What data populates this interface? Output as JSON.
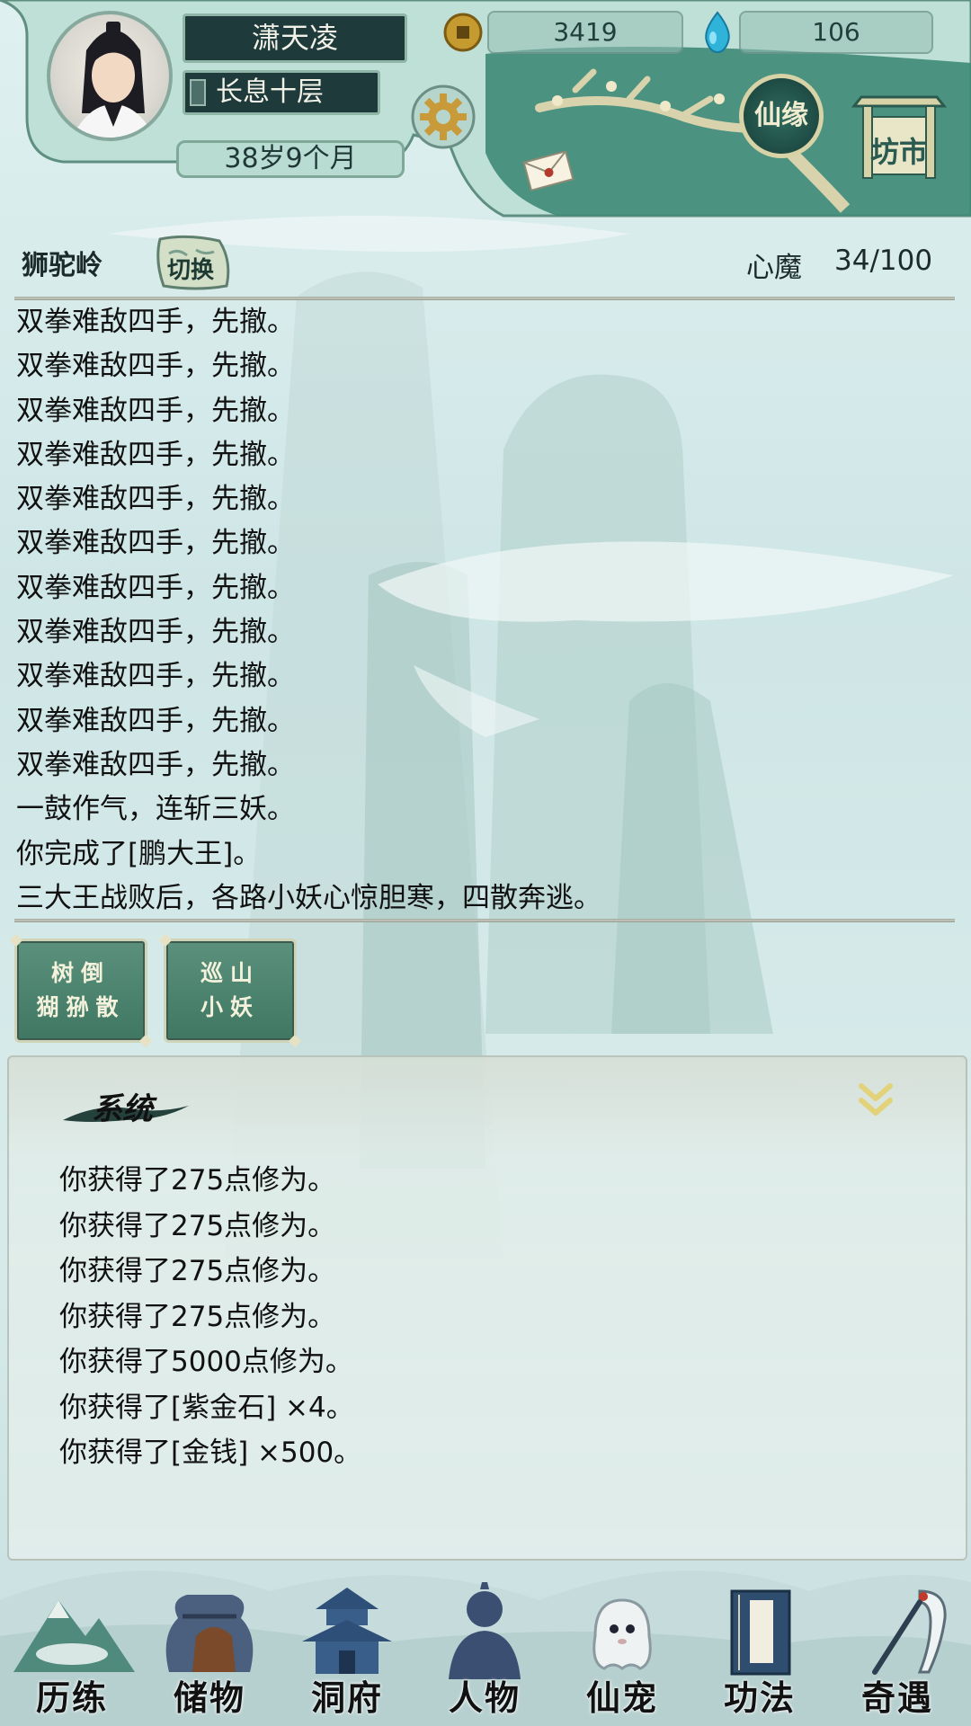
{
  "player": {
    "name": "潇天凌",
    "realm": "长息十层",
    "age": "38岁9个月"
  },
  "resources": {
    "coins": "3419",
    "gems": "106"
  },
  "header_buttons": {
    "xianyuan": "仙缘",
    "fangshi": "坊市"
  },
  "location": {
    "name": "狮驼岭",
    "switch_label": "切换"
  },
  "xinmo": {
    "label": "心魔",
    "value": "34/100"
  },
  "story_log": [
    "双拳难敌四手，先撤。",
    "双拳难敌四手，先撤。",
    "双拳难敌四手，先撤。",
    "双拳难敌四手，先撤。",
    "双拳难敌四手，先撤。",
    "双拳难敌四手，先撤。",
    "双拳难敌四手，先撤。",
    "双拳难敌四手，先撤。",
    "双拳难敌四手，先撤。",
    "双拳难敌四手，先撤。",
    "双拳难敌四手，先撤。",
    "一鼓作气，连斩三妖。",
    "你完成了[鹏大王]。",
    "三大王战败后，各路小妖心惊胆寒，四散奔逃。"
  ],
  "options": [
    {
      "line1": "树倒",
      "line2": "猢狲散"
    },
    {
      "line1": "巡山",
      "line2": "小妖"
    }
  ],
  "system": {
    "title": "系统",
    "messages": [
      "你获得了275点修为。",
      "你获得了275点修为。",
      "你获得了275点修为。",
      "你获得了275点修为。",
      "你获得了5000点修为。",
      "你获得了[紫金石] ×4。",
      "你获得了[金钱] ×500。"
    ]
  },
  "nav": [
    {
      "label": "历练",
      "icon": "mountain-icon"
    },
    {
      "label": "储物",
      "icon": "bag-icon"
    },
    {
      "label": "洞府",
      "icon": "pagoda-icon"
    },
    {
      "label": "人物",
      "icon": "person-icon"
    },
    {
      "label": "仙宠",
      "icon": "ghost-pet-icon"
    },
    {
      "label": "功法",
      "icon": "book-icon"
    },
    {
      "label": "奇遇",
      "icon": "crane-icon"
    }
  ],
  "colors": {
    "header_teal": "#2f6b5f",
    "option_green": "#4f8670",
    "plate_dark": "#1f3a3a"
  }
}
